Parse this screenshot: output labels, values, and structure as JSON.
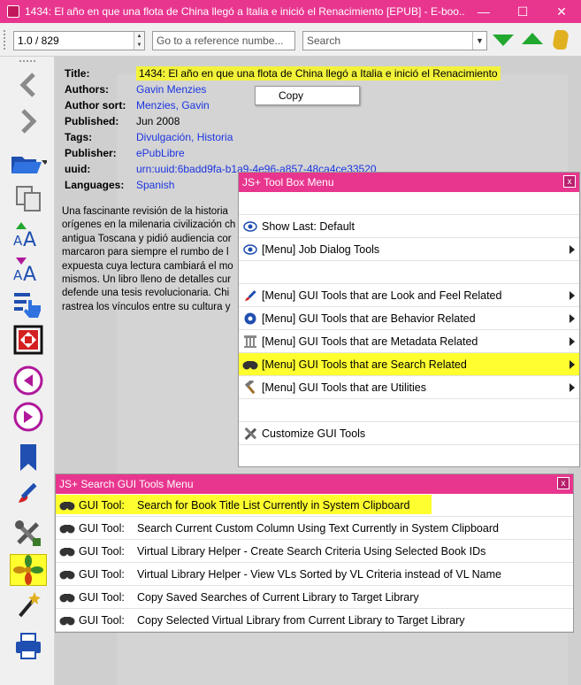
{
  "window": {
    "title": "1434: El año en que una flota de China llegó a Italia e inició el Renacimiento [EPUB] - E-boo...",
    "minimize": "—",
    "maximize": "☐",
    "close": "✕"
  },
  "toolbar": {
    "page_value": "1.0 / 829",
    "reference_placeholder": "Go to a reference numbe...",
    "search_placeholder": "Search",
    "icons": [
      "next-match-icon",
      "previous-match-icon",
      "scroll-icon"
    ]
  },
  "sidebar": {
    "icons": [
      "back-icon",
      "forward-icon",
      "open-book-icon",
      "copy-icon",
      "increase-font-icon",
      "decrease-font-icon",
      "select-icon",
      "fullscreen-icon",
      "previous-page-icon",
      "next-page-icon",
      "bookmark-icon",
      "paint-icon",
      "tools-icon",
      "plugin-icon",
      "wand-icon",
      "print-icon"
    ],
    "active": "plugin-icon"
  },
  "metadata": {
    "rows": [
      {
        "key": "Title:",
        "value": "1434: El año en que una flota de China llegó a Italia e inició el Renacimiento"
      },
      {
        "key": "Authors:",
        "value": "Gavin Menzies"
      },
      {
        "key": "Author sort:",
        "value": "Menzies, Gavin"
      },
      {
        "key": "Published:",
        "value": "Jun 2008"
      },
      {
        "key": "Tags:",
        "value": "Divulgación, Historia"
      },
      {
        "key": "Publisher:",
        "value": "ePubLibre"
      },
      {
        "key": "uuid:",
        "value": "urn:uuid:6badd9fa-b1a9-4e96-a857-48ca4ce33520"
      },
      {
        "key": "Languages:",
        "value": "Spanish"
      }
    ],
    "description_lines": [
      "Una fascinante revisión de la historia",
      "orígenes en la milenaria civilización ch",
      "antigua Toscana y pidió audiencia cor",
      "marcaron para siempre el rumbo de l",
      "expuesta cuya lectura cambiará el mo",
      "mismos. Un libro lleno de detalles cur",
      "defende una tesis revolucionaria. Chi",
      "rastrea los vínculos entre su cultura y"
    ]
  },
  "context_menu": {
    "copy": "Copy"
  },
  "toolbox_menu": {
    "title": "JS+ Tool Box Menu",
    "close": "x",
    "items": [
      {
        "label": "Show Last: Default",
        "icon": "eye-icon"
      },
      {
        "label": "[Menu] Job Dialog Tools",
        "icon": "eye-icon"
      },
      {
        "label": "[Menu] GUI Tools that are Look and Feel Related",
        "icon": "brush-icon"
      },
      {
        "label": "[Menu] GUI Tools that are Behavior Related",
        "icon": "gear-icon"
      },
      {
        "label": "[Menu] GUI Tools that are Metadata Related",
        "icon": "column-icon"
      },
      {
        "label": "[Menu] GUI Tools that are Search Related",
        "icon": "binoculars-icon"
      },
      {
        "label": "[Menu] GUI Tools that are Utilities",
        "icon": "hammer-icon"
      },
      {
        "label": "Customize GUI Tools",
        "icon": "tools-icon"
      }
    ]
  },
  "search_menu": {
    "title": "JS+ Search GUI Tools Menu",
    "close": "x",
    "prefix": "GUI Tool:",
    "items": [
      "Search for Book Title List Currently in System Clipboard",
      "Search Current Custom Column Using Text Currently in System Clipboard",
      "Virtual Library Helper - Create Search Criteria Using Selected Book IDs",
      "Virtual Library Helper - View VLs Sorted by VL Criteria instead of VL Name",
      "Copy Saved Searches of Current Library to Target Library",
      "Copy Selected Virtual Library from Current Library to Target Library"
    ]
  },
  "colors": {
    "titlebar": "#e8368f",
    "highlight": "#ffff30",
    "link": "#1a34e0",
    "arrow_green": "#22a72f"
  }
}
